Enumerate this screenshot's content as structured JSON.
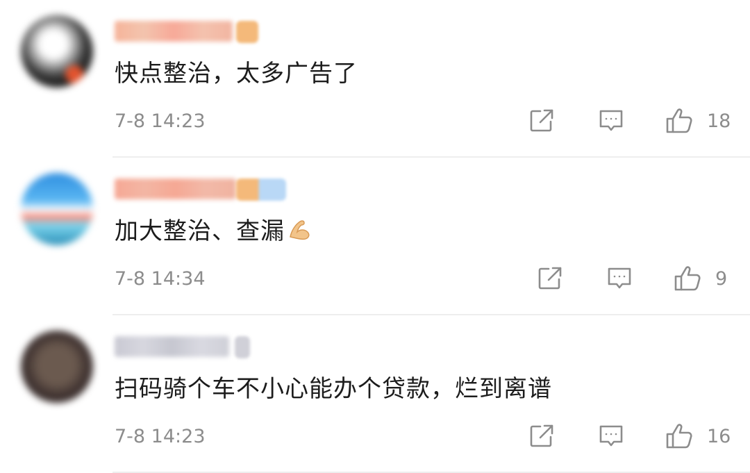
{
  "comments": [
    {
      "text": "快点整治，太多广告了",
      "time": "7-8 14:23",
      "likes": "18",
      "avatar_icon": "user-avatar-blurred",
      "nickname_blurred": true
    },
    {
      "text": "加大整治、查漏",
      "emoji": "flexed-biceps-icon",
      "time": "7-8 14:34",
      "likes": "9",
      "avatar_icon": "user-avatar-blurred",
      "nickname_blurred": true
    },
    {
      "text": "扫码骑个车不小心能办个贷款，烂到离谱",
      "time": "7-8 14:23",
      "likes": "16",
      "avatar_icon": "user-avatar-blurred",
      "nickname_blurred": true
    }
  ],
  "colors": {
    "text": "#1c1c1c",
    "meta": "#8c8c8c",
    "divider": "#eeeeee"
  }
}
